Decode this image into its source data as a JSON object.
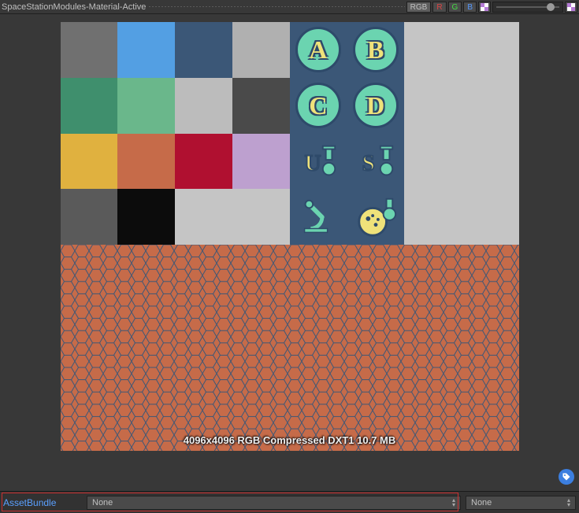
{
  "header": {
    "title": "SpaceStationModules-Material-Active",
    "channel_rgb": "RGB",
    "channel_r": "R",
    "channel_g": "G",
    "channel_b": "B"
  },
  "texture": {
    "grid_colors": [
      [
        "#707070",
        "#539fe3",
        "#3b5777",
        "#b0b0b0",
        null,
        null,
        "#c5c5c5",
        "#c5c5c5"
      ],
      [
        "#3f8f6d",
        "#6ab78b",
        "#bcbcbc",
        "#4a4a4a",
        null,
        null,
        "#c5c5c5",
        "#c5c5c5"
      ],
      [
        "#e0b13f",
        "#c66b49",
        "#b01030",
        "#bda0cf",
        null,
        null,
        "#c5c5c5",
        "#c5c5c5"
      ],
      [
        "#5a5a5a",
        "#0c0c0c",
        "#c5c5c5",
        "#c5c5c5",
        null,
        null,
        "#c5c5c5",
        "#c5c5c5"
      ]
    ],
    "icon_labels": {
      "a": "A",
      "b": "B",
      "c": "C",
      "d": "D",
      "u": "U",
      "s": "S"
    },
    "info": "4096x4096  RGB Compressed DXT1   10.7 MB"
  },
  "footer": {
    "label": "AssetBundle",
    "bundle_value": "None",
    "variant_value": "None"
  }
}
